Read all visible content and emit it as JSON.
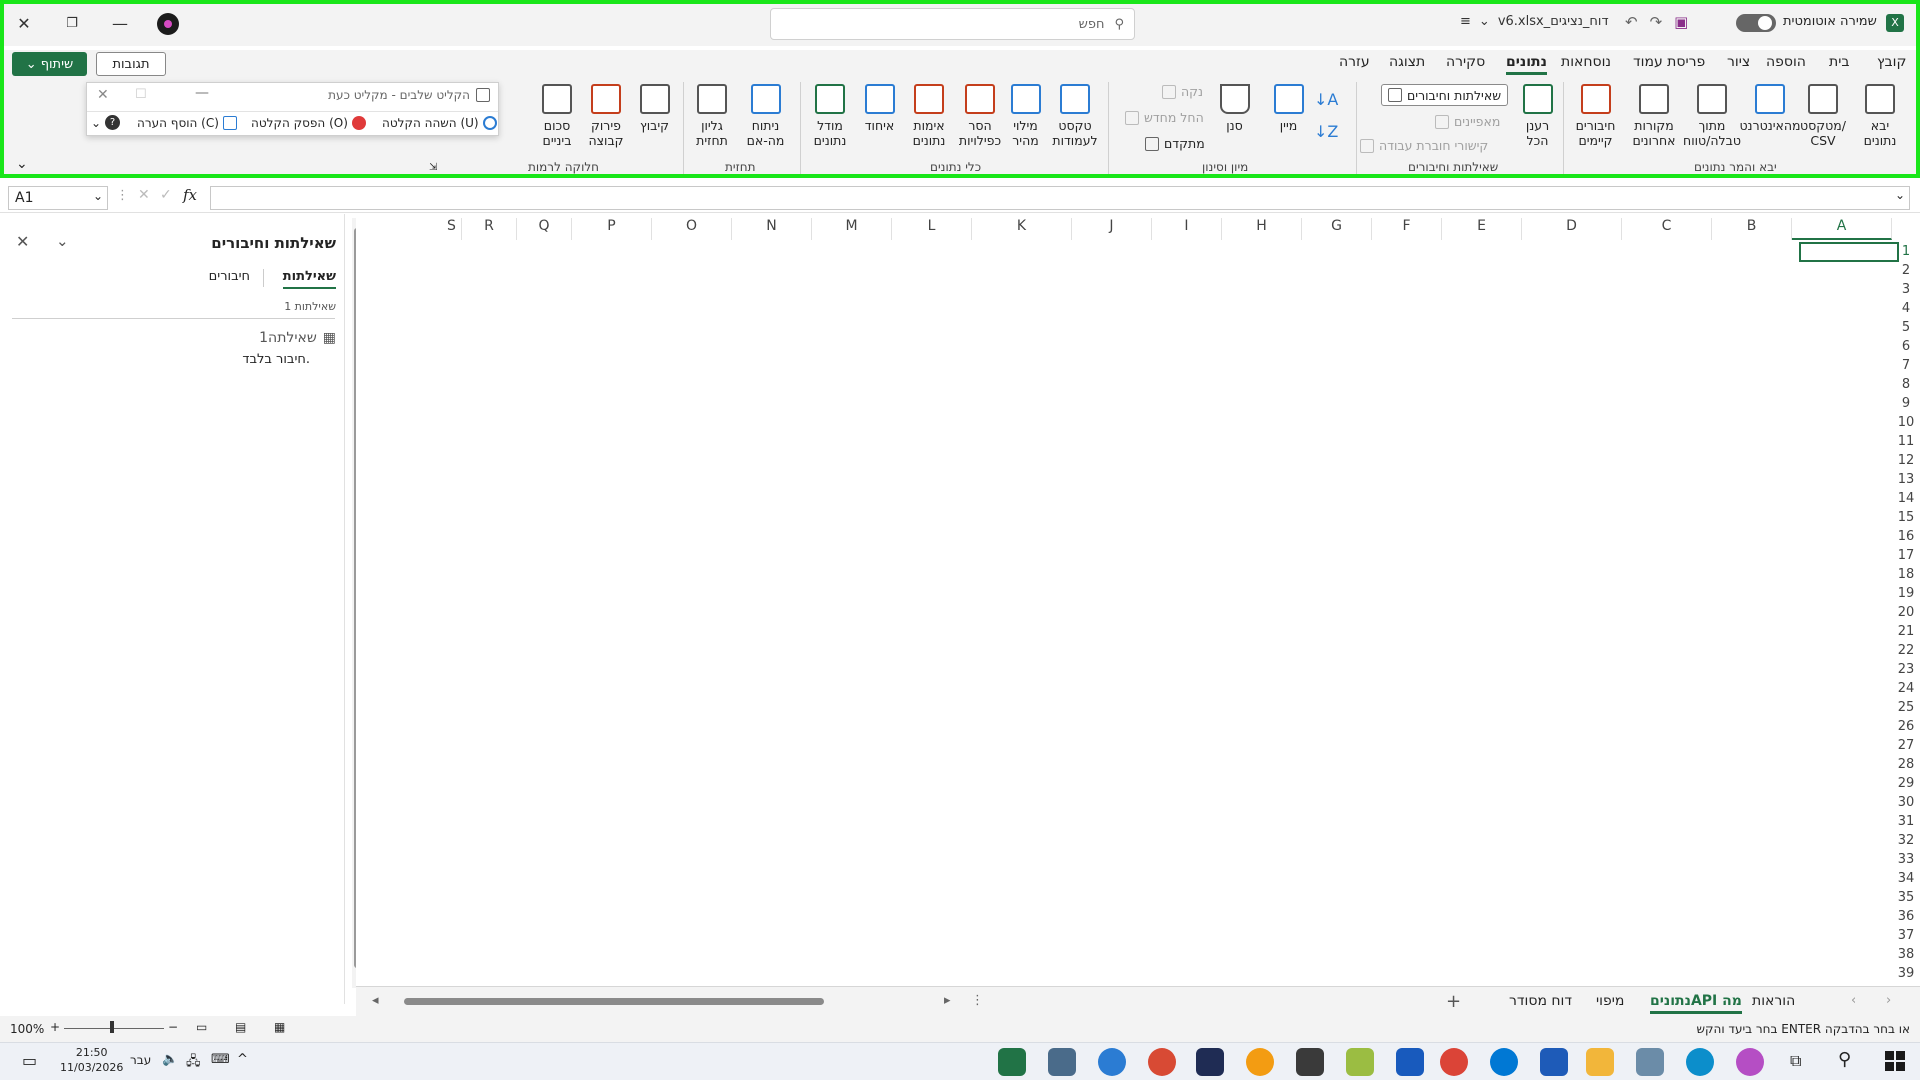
{
  "titlebar": {
    "autosave_label": "שמירה אוטומטית",
    "filename": "v6.xlsx_דוח_נציגים",
    "search_placeholder": "חפש",
    "share_label": "שיתוף",
    "comments_label": "תגובות"
  },
  "tabs": [
    "קובץ",
    "בית",
    "הוספה",
    "ציור",
    "פריסת עמוד",
    "נוסחאות",
    "נתונים",
    "סקירה",
    "תצוגה",
    "עזרה"
  ],
  "active_tab": "נתונים",
  "ribbon": {
    "get_data": [
      "יבא",
      "נתונים"
    ],
    "from_text_csv": [
      "מטקסט/",
      "CSV"
    ],
    "from_web": [
      "מהאינטרנט"
    ],
    "from_table": [
      "מתוך",
      "טבלה/טווח"
    ],
    "recent_sources": [
      "מקורות",
      "אחרונים"
    ],
    "existing_connections": [
      "חיבורים",
      "קיימים"
    ],
    "group_get": "יבא והמר נתונים",
    "refresh_all": [
      "רענן",
      "הכל"
    ],
    "queries_connections": "שאילתות וחיבורים",
    "properties": "מאפיינים",
    "workbook_links": "קישורי חוברת עבודה",
    "group_queries": "שאילתות וחיבורים",
    "sort": "מיין",
    "filter": "סנן",
    "clear": "נקה",
    "reapply": "החל מחדש",
    "advanced": "מתקדם",
    "group_sort": "מיון וסינון",
    "text_to_columns": [
      "טקסט",
      "לעמודות"
    ],
    "flash_fill": [
      "מילוי",
      "מהיר"
    ],
    "remove_duplicates": [
      "הסר",
      "כפילויות"
    ],
    "data_validation": [
      "אימות",
      "נתונים"
    ],
    "consolidate": [
      "איחוד"
    ],
    "data_model": [
      "מודל",
      "נתונים"
    ],
    "group_tools": "כלי נתונים",
    "what_if": [
      "ניתוח",
      "מה-אם"
    ],
    "forecast_sheet": [
      "גליון",
      "תחזית"
    ],
    "group_forecast": "תחזית",
    "group": [
      "קיבוץ"
    ],
    "ungroup": [
      "פירוק",
      "קבוצה"
    ],
    "subtotal": [
      "סכום",
      "ביניים"
    ],
    "group_outline": "חלוקה לרמות"
  },
  "recorder": {
    "title": "הקליט שלבים - מקליט כעת",
    "pause": "השהה הקלטה (U)",
    "stop": "הפסק הקלטה (O)",
    "add_comment": "הוסף הערה (C)"
  },
  "formula_bar": {
    "name_box": "A1",
    "fx": "fx"
  },
  "task_pane": {
    "title": "שאילתות וחיבורים",
    "tab_queries": "שאילתות",
    "tab_connections": "חיבורים",
    "count": "שאילתות 1",
    "query_name": "שאילתה1",
    "query_desc": "חיבור בלבד."
  },
  "columns": [
    "A",
    "B",
    "C",
    "D",
    "E",
    "F",
    "G",
    "H",
    "I",
    "J",
    "K",
    "L",
    "M",
    "N",
    "O",
    "P",
    "Q",
    "R",
    "S"
  ],
  "rows": [
    "1",
    "2",
    "3",
    "4",
    "5",
    "6",
    "7",
    "8",
    "9",
    "10",
    "11",
    "12",
    "13",
    "14",
    "15",
    "16",
    "17",
    "18",
    "19",
    "20",
    "21",
    "22",
    "23",
    "24",
    "25",
    "26",
    "27",
    "28",
    "29",
    "30",
    "31",
    "32",
    "33",
    "34",
    "35",
    "36",
    "37",
    "38",
    "39"
  ],
  "sheet_tabs": [
    "הוראות",
    "נתוניםAPI מה",
    "מיפוי",
    "דוח מסודר"
  ],
  "active_sheet": "נתוניםAPI מה",
  "status": {
    "message": "בחר ביעד והקש ENTER או בחר בהדבקה",
    "zoom": "100%"
  },
  "taskbar": {
    "time": "21:50",
    "date": "11/03/2026",
    "lang": "עבר"
  },
  "colors": {
    "accent": "#217346",
    "highlight": "#19e619"
  }
}
